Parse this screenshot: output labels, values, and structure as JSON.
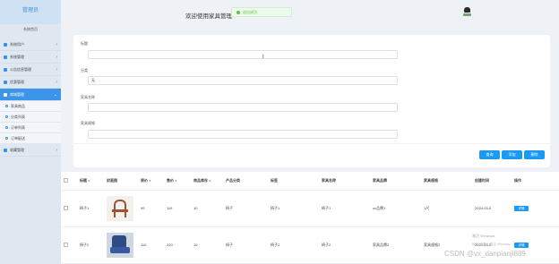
{
  "app": {
    "role": "管理员",
    "home": "系统首页"
  },
  "header": {
    "title": "欢迎使用家具管理",
    "toast": "退出成功"
  },
  "sidebar": {
    "items": [
      {
        "label": "系统用户"
      },
      {
        "label": "系统管理"
      },
      {
        "label": "公告信息管理"
      },
      {
        "label": "优惠管理"
      },
      {
        "label": "商城管理",
        "active": true
      }
    ],
    "subitems": [
      {
        "label": "家具商品"
      },
      {
        "label": "分类列表"
      },
      {
        "label": "订单列表"
      },
      {
        "label": "订单配送"
      }
    ],
    "after": [
      {
        "label": "收藏管理"
      }
    ]
  },
  "form": {
    "fields": [
      {
        "label": "标题",
        "value": ""
      },
      {
        "label": "分类",
        "value": "无"
      },
      {
        "label": "家具名称",
        "value": ""
      },
      {
        "label": "家具规格",
        "value": ""
      }
    ],
    "buttons": {
      "search": "查询",
      "add": "添加",
      "delete": "删除"
    }
  },
  "table": {
    "headers": [
      "标题",
      "封面图",
      "原价",
      "售价",
      "商品库存",
      "产品分类",
      "标签",
      "家具名称",
      "家具品牌",
      "家具规格",
      "创建时间",
      "操作"
    ],
    "rows": [
      {
        "title": "椅子1",
        "price": "99",
        "sale": "119",
        "stock": "10",
        "category": "椅子",
        "tag": "椅子1",
        "name": "椅子1",
        "brand": "xx品牌1",
        "spec": "1尺",
        "created": "2024-03-0",
        "action": "详情"
      },
      {
        "title": "椅子2",
        "price": "110",
        "sale": "220",
        "stock": "10",
        "category": "椅子",
        "tag": "椅子2",
        "name": "椅子2",
        "brand": "家具品牌2",
        "spec": "家具规格2",
        "created": "2024-03-0",
        "action": "详情"
      }
    ]
  },
  "watermark": {
    "line1": "激活 Windows",
    "line2": "转到\"设置\"以激活 Windows。",
    "csdn": "CSDN @vx_danpianji889"
  },
  "colors": {
    "primary": "#1a9af0",
    "sidebarActive": "#3b95ea",
    "success": "#67c23a"
  }
}
